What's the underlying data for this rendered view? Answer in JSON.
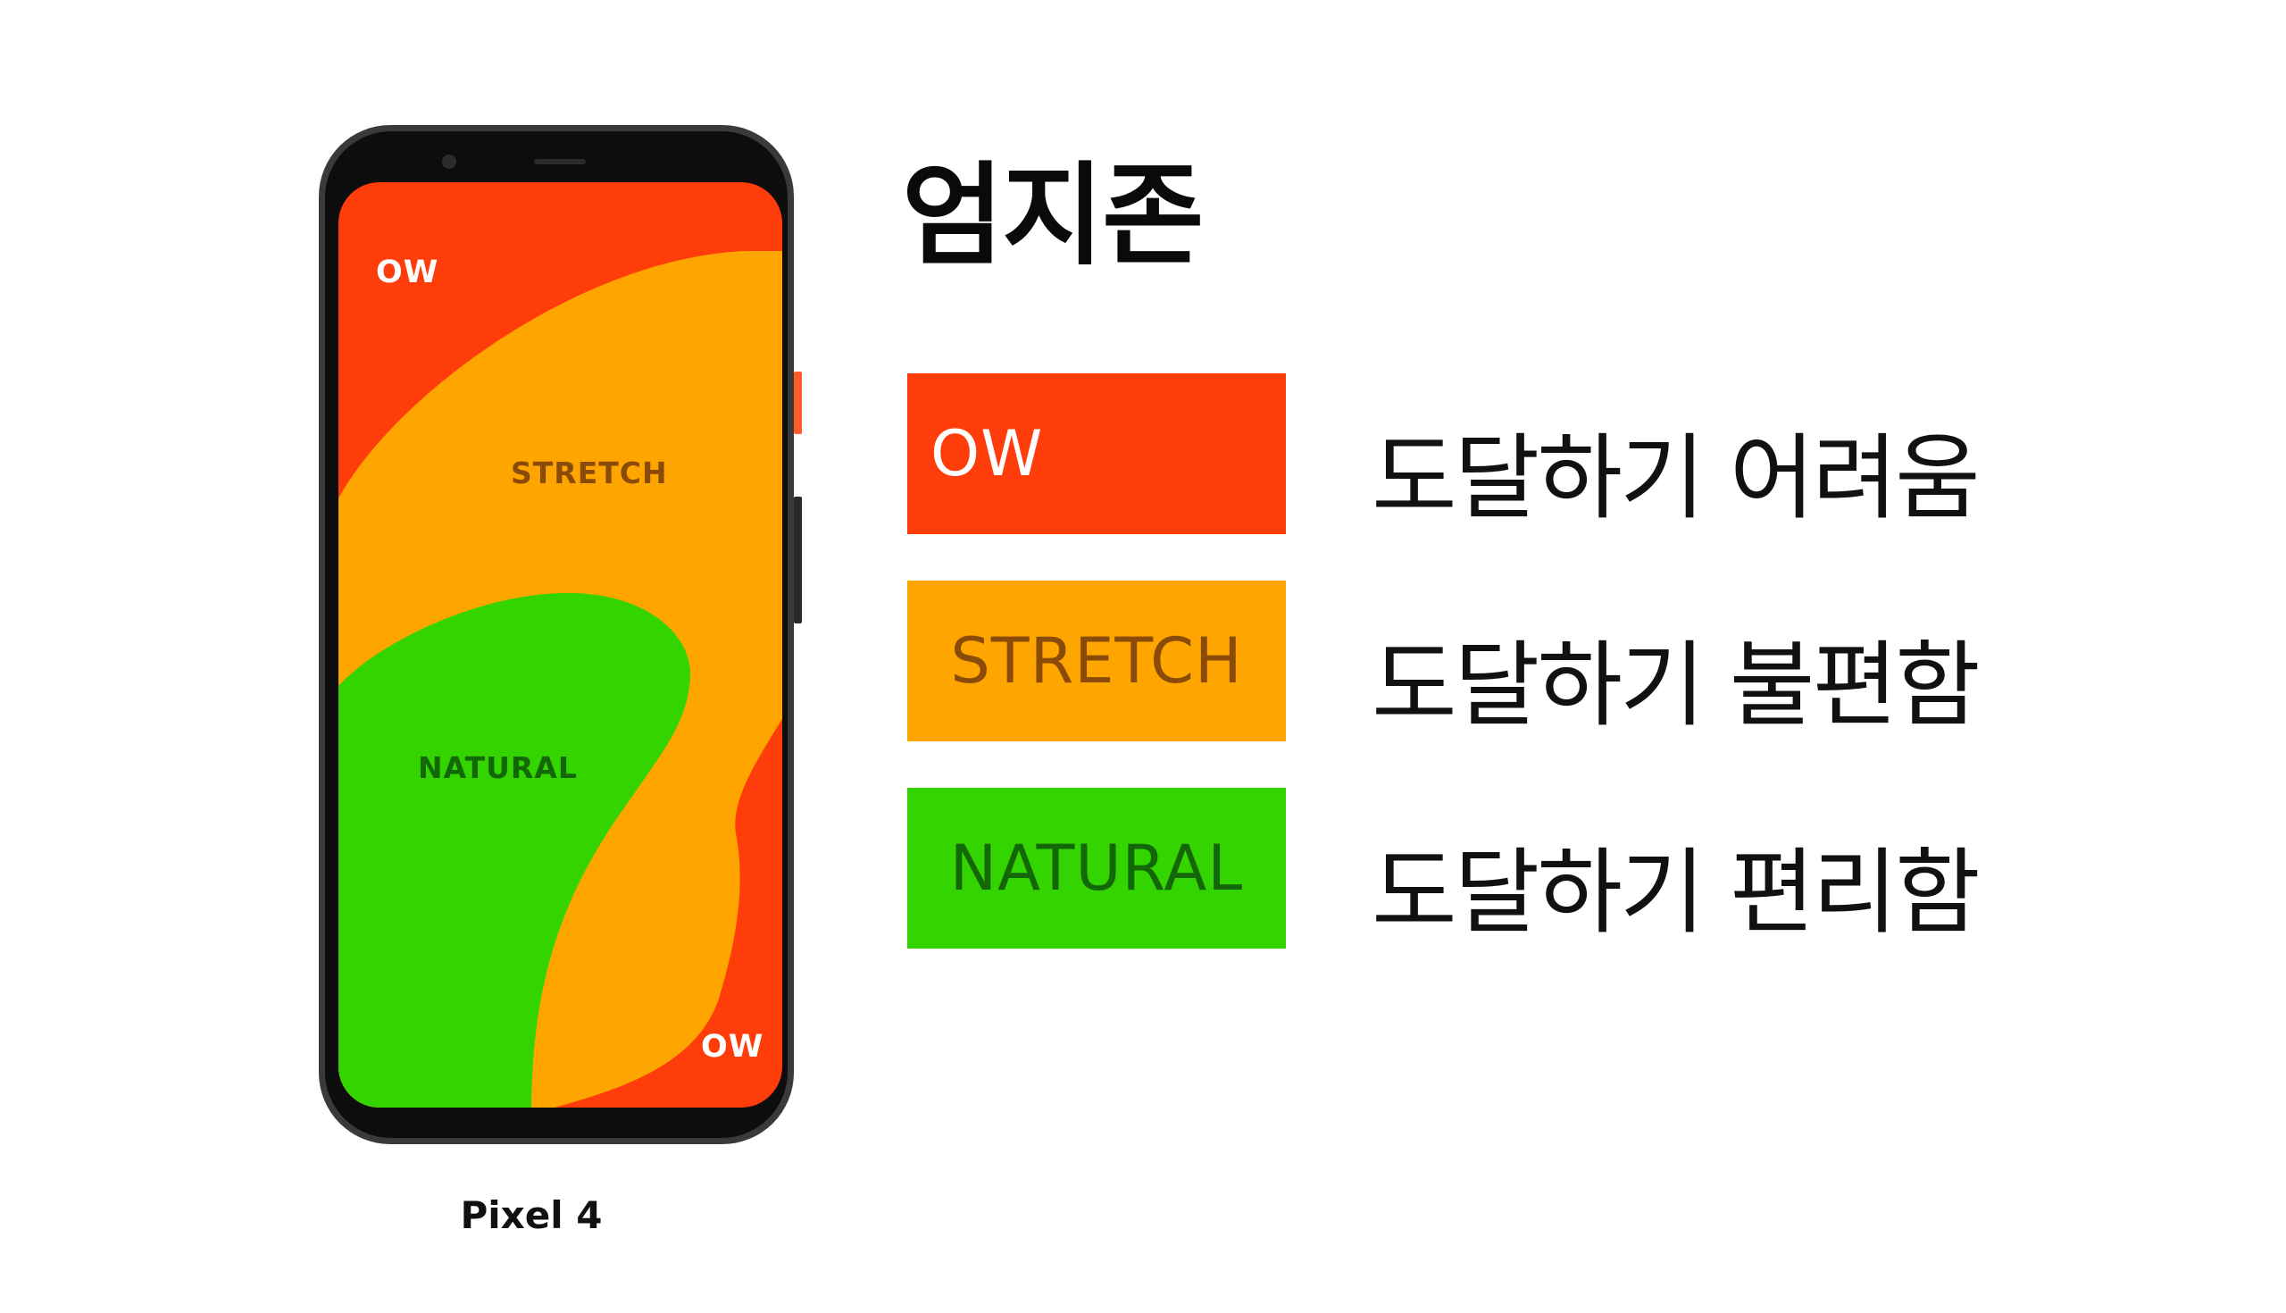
{
  "colors": {
    "ow": "#FF3D0B",
    "stretch": "#FFA500",
    "natural": "#33D400",
    "stretch_text": "#8A4A08",
    "natural_text": "#136708",
    "ow_text": "#FFFFFF"
  },
  "phone": {
    "model_label": "Pixel 4",
    "zones": {
      "ow_top": "OW",
      "stretch": "STRETCH",
      "natural": "NATURAL",
      "ow_bottom": "OW"
    }
  },
  "title": "엄지존",
  "legend": [
    {
      "key": "ow",
      "label": "OW",
      "description": "도달하기 어려움"
    },
    {
      "key": "stretch",
      "label": "STRETCH",
      "description": "도달하기 불편함"
    },
    {
      "key": "natural",
      "label": "NATURAL",
      "description": "도달하기 편리함"
    }
  ]
}
